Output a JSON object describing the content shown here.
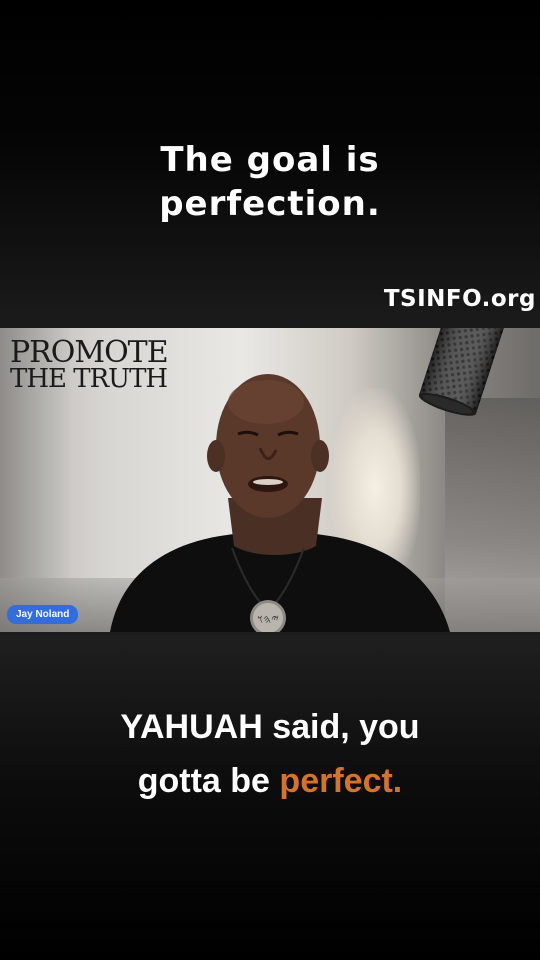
{
  "top_caption": {
    "line1": "The goal is",
    "line2": "perfection."
  },
  "site_label": "TSINFO.org",
  "video": {
    "logo": {
      "line1": "PROMOTE",
      "line2": "THE TRUTH",
      "script": "𐤉𐤄𐤅𐤄"
    },
    "name_tag": "Jay Noland"
  },
  "bottom_caption": {
    "line1": "YAHUAH said, you",
    "line2_prefix": "gotta be ",
    "line2_highlight": "perfect."
  },
  "colors": {
    "background": "#000000",
    "caption_text": "#ffffff",
    "highlight": "#d9731f",
    "name_tag_bg": "#2f6de0"
  }
}
